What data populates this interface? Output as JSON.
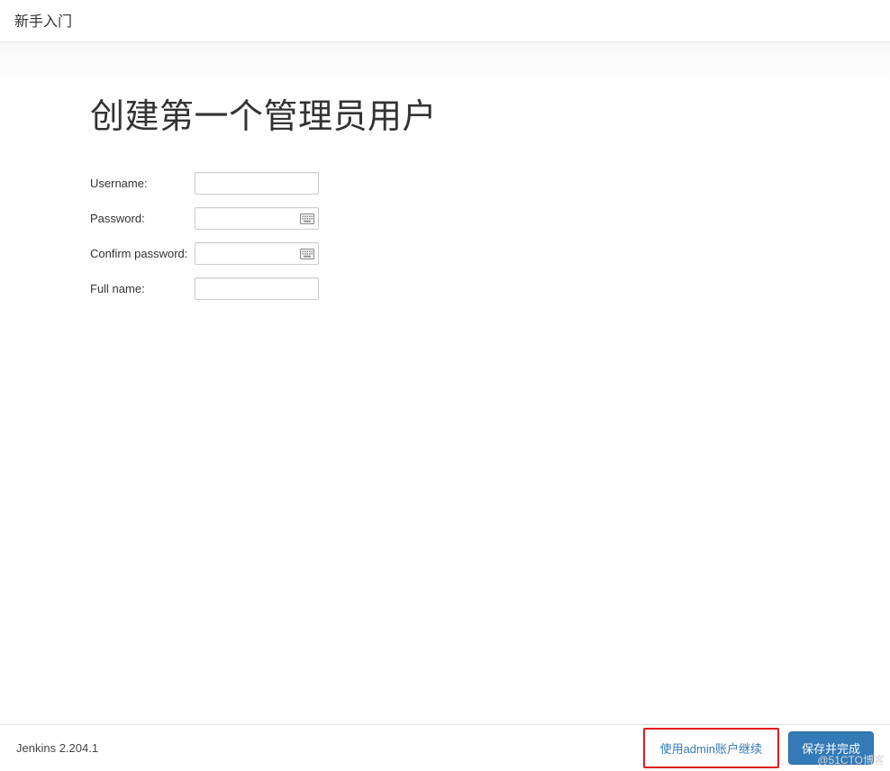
{
  "header": {
    "title": "新手入门"
  },
  "main": {
    "heading": "创建第一个管理员用户",
    "form": {
      "username": {
        "label": "Username:",
        "value": ""
      },
      "password": {
        "label": "Password:",
        "value": ""
      },
      "confirm": {
        "label": "Confirm password:",
        "value": ""
      },
      "fullname": {
        "label": "Full name:",
        "value": ""
      }
    }
  },
  "footer": {
    "version": "Jenkins 2.204.1",
    "continue_as_admin": "使用admin账户继续",
    "save_and_finish": "保存并完成"
  },
  "watermark": "@51CTO博客"
}
